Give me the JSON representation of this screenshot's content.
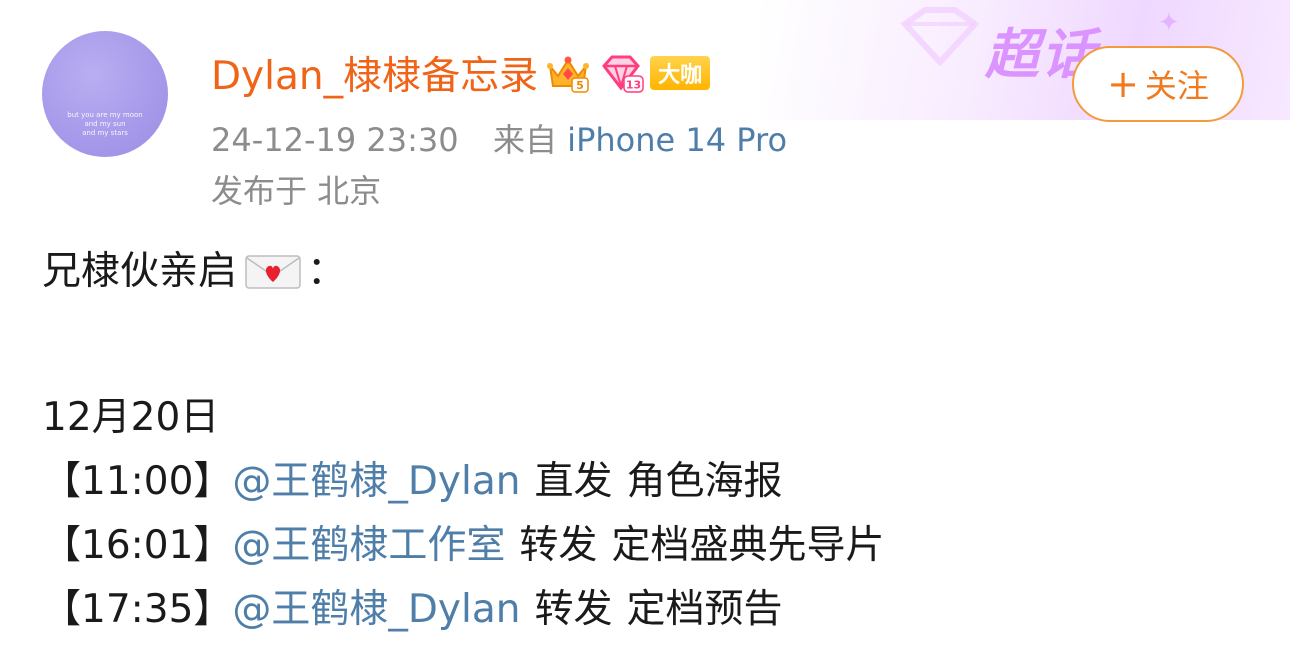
{
  "banner": {
    "super_topic_label": "超话"
  },
  "post": {
    "username": "Dylan_棣棣备忘录",
    "badges": {
      "crown_level": "5",
      "gem_level": "13",
      "dk_label": "大咖"
    },
    "timestamp": "24-12-19 23:30",
    "source_prefix": "来自",
    "source_device": "iPhone 14 Pro",
    "location": "发布于 北京",
    "follow_label": "关注",
    "avatar_caption": [
      "but you are my moon",
      "and my sun",
      "and my stars"
    ]
  },
  "content": {
    "greeting": "兄棣伙亲启",
    "greeting_suffix": "：",
    "date": "12月20日",
    "schedule": [
      {
        "time": "【11:00】",
        "mention": "@王鹤棣_Dylan",
        "action": "直发",
        "item": "角色海报"
      },
      {
        "time": "【16:01】",
        "mention": "@王鹤棣工作室",
        "action": "转发",
        "item": "定档盛典先导片"
      },
      {
        "time": "【17:35】",
        "mention": "@王鹤棣_Dylan",
        "action": "转发",
        "item": "定档预告"
      }
    ]
  },
  "colors": {
    "username": "#f06418",
    "mention": "#4f7ea8",
    "meta": "#8c8c8c",
    "follow": "#f07a1e"
  },
  "icons": {
    "crown": "crown-icon",
    "gem": "gem-icon",
    "envelope": "love-letter-icon",
    "plus": "plus-icon"
  }
}
